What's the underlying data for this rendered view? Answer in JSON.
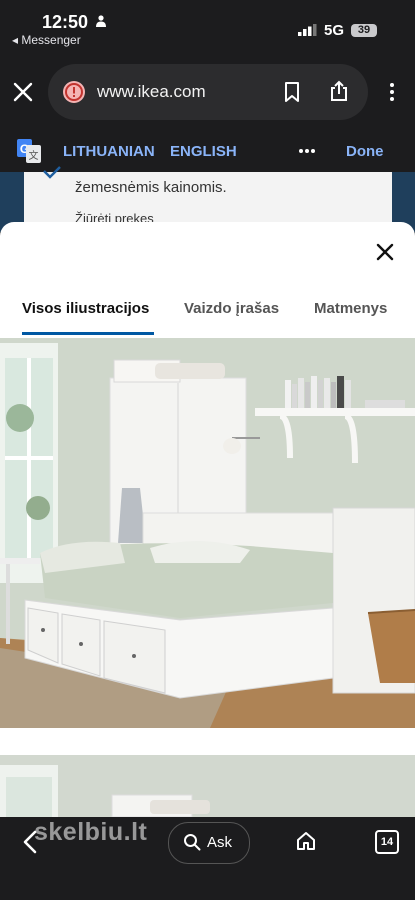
{
  "status_bar": {
    "time": "12:50",
    "back_app": "◂ Messenger",
    "network": "5G",
    "battery": "39"
  },
  "browser": {
    "url": "www.ikea.com"
  },
  "translate_bar": {
    "source_lang": "LITHUANIAN",
    "target_lang": "ENGLISH",
    "done_label": "Done"
  },
  "background_page": {
    "text_line": "žemesnėmis kainomis.",
    "link_text": "Žiūrėti prekes"
  },
  "modal": {
    "tabs": [
      {
        "label": "Visos iliustracijos",
        "active": true
      },
      {
        "label": "Vaizdo įrašas",
        "active": false
      },
      {
        "label": "Matmenys",
        "active": false
      }
    ]
  },
  "bottom_bar": {
    "ask_label": "Ask",
    "tab_count": "14",
    "watermark": "skelbiu.lt"
  },
  "colors": {
    "accent_blue": "#8ab4f8",
    "tab_underline": "#0058a3",
    "dark_chrome": "#1c1c1e"
  }
}
